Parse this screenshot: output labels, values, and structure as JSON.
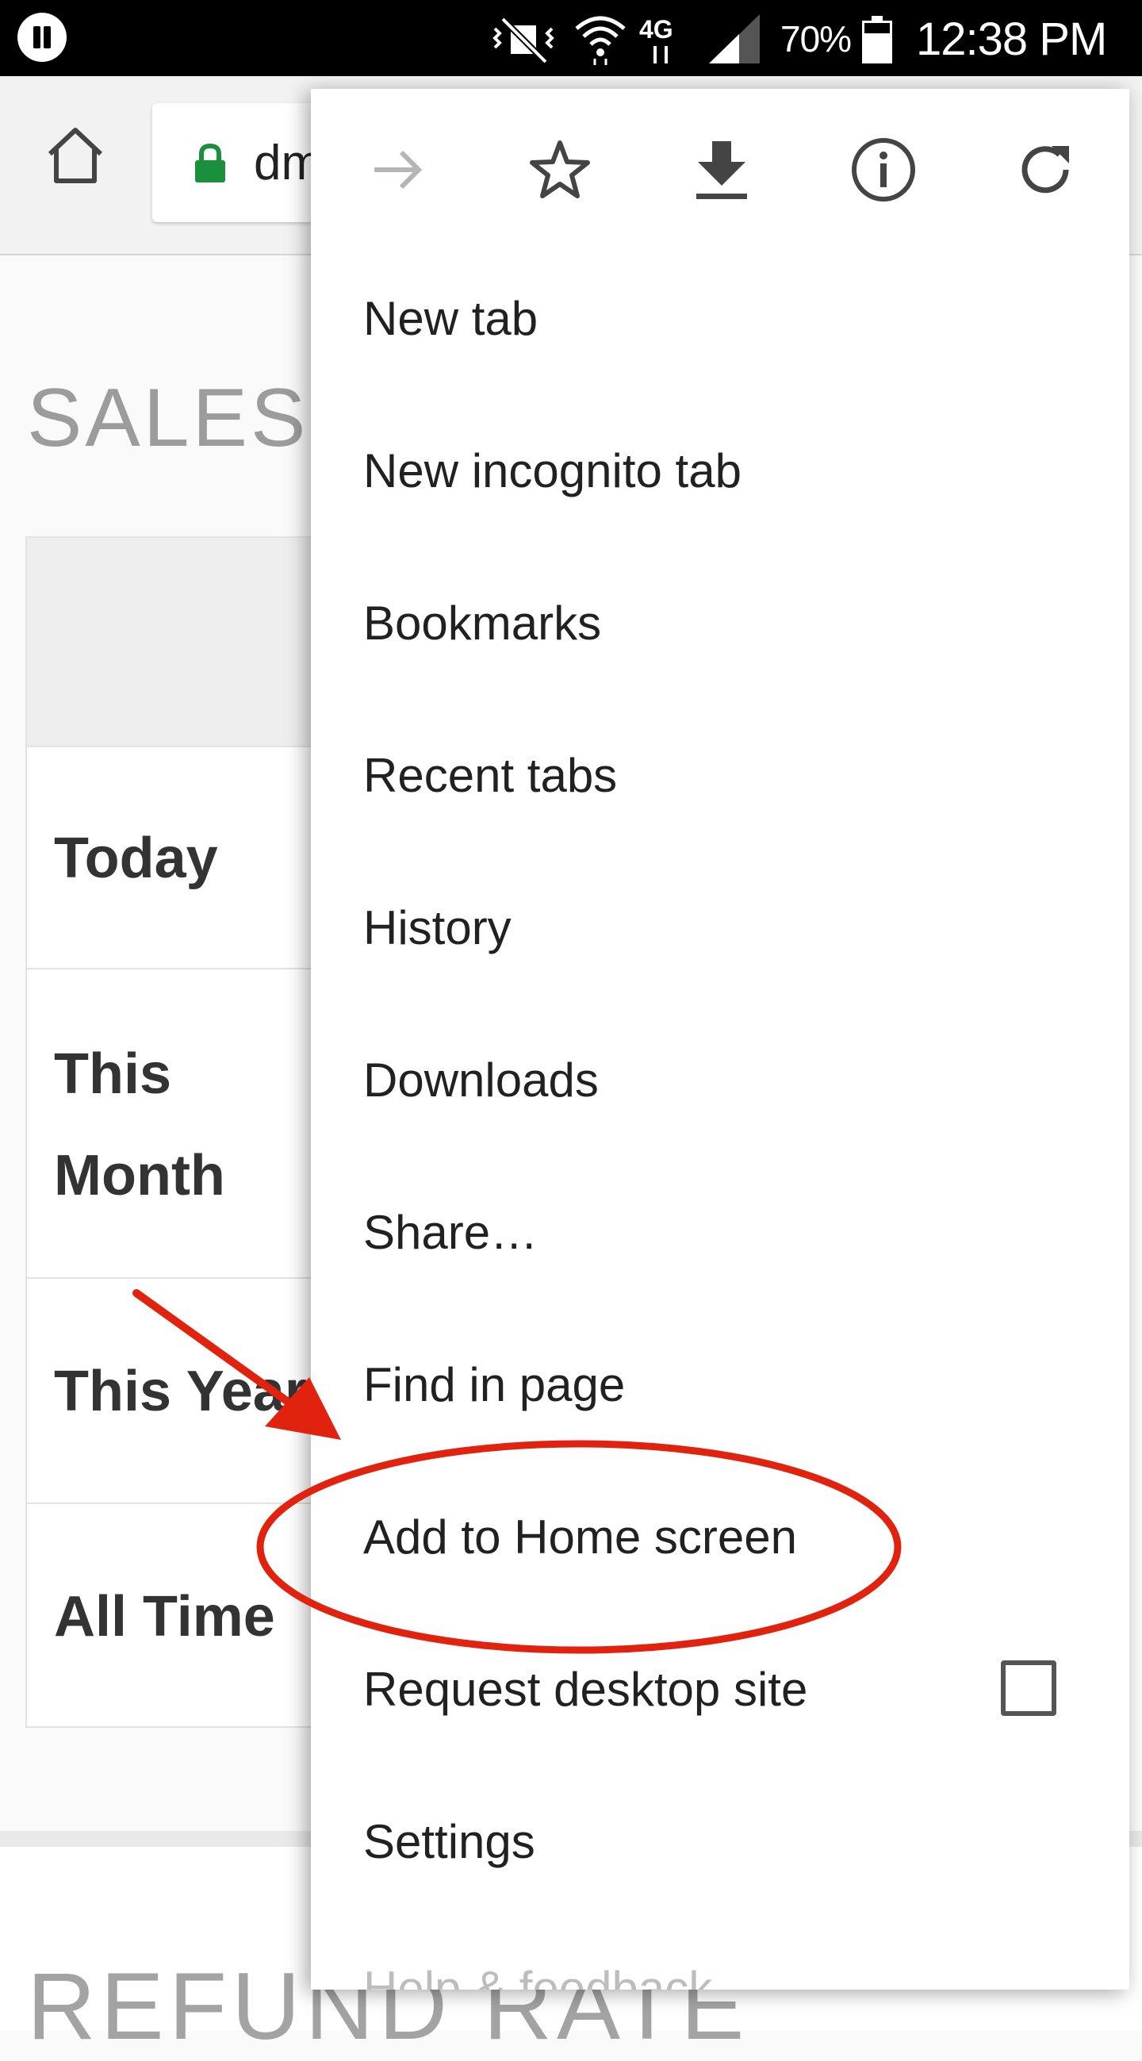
{
  "status_bar": {
    "battery": "70%",
    "time": "12:38 PM",
    "network": "4G"
  },
  "browser": {
    "url_partial": "dm",
    "icons": [
      "home-icon",
      "lock-icon"
    ]
  },
  "page": {
    "heading": "SALES",
    "rows": [
      "Today",
      "This Month",
      "This Year",
      "All Time"
    ],
    "section_heading": "REFUND RATE"
  },
  "menu": {
    "top_icons": [
      "forward-icon",
      "star-icon",
      "download-icon",
      "info-icon",
      "reload-icon"
    ],
    "items": [
      "New tab",
      "New incognito tab",
      "Bookmarks",
      "Recent tabs",
      "History",
      "Downloads",
      "Share…",
      "Find in page",
      "Add to Home screen",
      "Request desktop site",
      "Settings"
    ],
    "partially_hidden_item": "Help & feedback"
  },
  "colors": {
    "annotation": "#e0220e",
    "lock": "#1a8f3c"
  }
}
